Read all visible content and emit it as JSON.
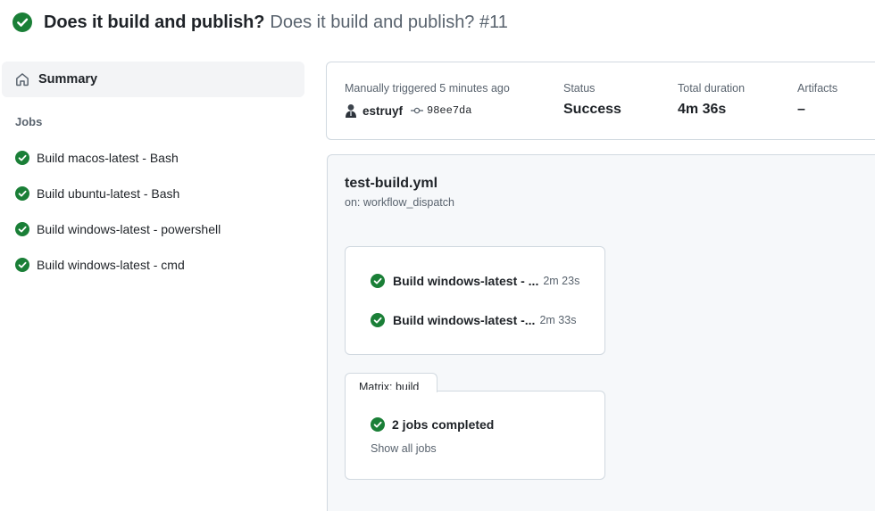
{
  "header": {
    "status_icon": "check-circle-fill-icon",
    "title": "Does it build and publish?",
    "subtitle": "Does it build and publish? #11"
  },
  "sidebar": {
    "summary_icon": "home-icon",
    "summary_label": "Summary",
    "jobs_heading": "Jobs",
    "jobs": [
      {
        "label": "Build macos-latest - Bash",
        "status": "success"
      },
      {
        "label": "Build ubuntu-latest - Bash",
        "status": "success"
      },
      {
        "label": "Build windows-latest - powershell",
        "status": "success"
      },
      {
        "label": "Build windows-latest - cmd",
        "status": "success"
      }
    ]
  },
  "run_info": {
    "trigger_text": "Manually triggered 5 minutes ago",
    "actor": "estruyf",
    "commit": "98ee7da",
    "status_label": "Status",
    "status_value": "Success",
    "duration_label": "Total duration",
    "duration_value": "4m 36s",
    "artifacts_label": "Artifacts",
    "artifacts_value": "–"
  },
  "workflow_graph": {
    "file_name": "test-build.yml",
    "trigger": "on: workflow_dispatch",
    "jobs": [
      {
        "name": "Build windows-latest - ...",
        "duration": "2m 23s"
      },
      {
        "name": "Build windows-latest -...",
        "duration": "2m 33s"
      }
    ],
    "matrix": {
      "tab_label": "Matrix: build",
      "status_text": "2 jobs completed",
      "show_all_label": "Show all jobs"
    }
  },
  "colors": {
    "success": "#1a7f37",
    "muted_text": "#59636e",
    "border": "#d1d9e0",
    "graph_bg": "#f6f8fa"
  }
}
